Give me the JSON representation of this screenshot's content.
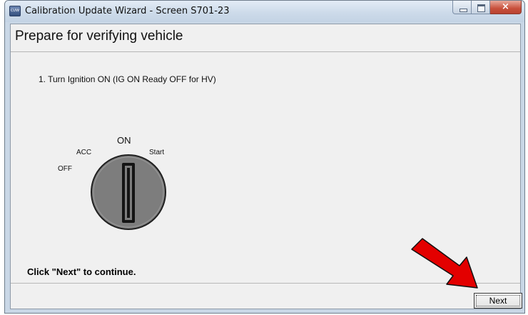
{
  "window": {
    "title": "Calibration Update Wizard - Screen S701-23",
    "app_icon_text": "CUW"
  },
  "page": {
    "title": "Prepare for verifying vehicle",
    "instruction": "1. Turn Ignition ON (IG ON Ready OFF for HV)",
    "footer_instruction": "Click \"Next\" to continue."
  },
  "ignition_switch": {
    "labels": {
      "off": "OFF",
      "acc": "ACC",
      "on": "ON",
      "start": "Start"
    }
  },
  "buttons": {
    "next_label": "Next"
  },
  "colors": {
    "arrow": "#e30000",
    "window_frame": "#c9d7e6",
    "content_bg": "#f0f0f0",
    "close_button": "#c8503c"
  }
}
